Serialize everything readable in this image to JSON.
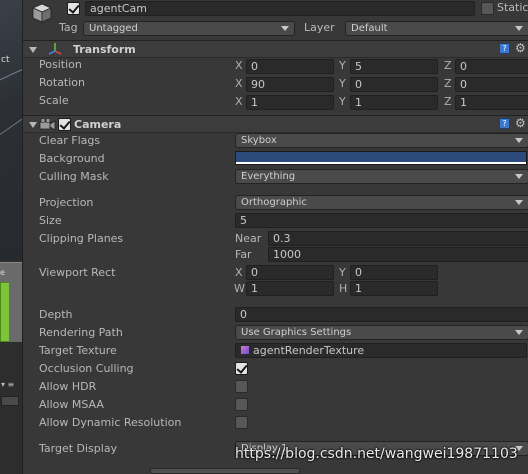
{
  "gameobject": {
    "name": "agentCam",
    "active": true,
    "static_label": "Static",
    "static": false,
    "tag_label": "Tag",
    "tag_value": "Untagged",
    "layer_label": "Layer",
    "layer_value": "Default"
  },
  "transform": {
    "title": "Transform",
    "position": {
      "label": "Position",
      "x": "0",
      "y": "5",
      "z": "0"
    },
    "rotation": {
      "label": "Rotation",
      "x": "90",
      "y": "0",
      "z": "0"
    },
    "scale": {
      "label": "Scale",
      "x": "1",
      "y": "1",
      "z": "1"
    }
  },
  "axes": {
    "x": "X",
    "y": "Y",
    "z": "Z",
    "w": "W",
    "h": "H"
  },
  "camera": {
    "title": "Camera",
    "enabled": true,
    "clear_flags": {
      "label": "Clear Flags",
      "value": "Skybox"
    },
    "background": {
      "label": "Background",
      "color": "#2d4a7c"
    },
    "culling_mask": {
      "label": "Culling Mask",
      "value": "Everything"
    },
    "projection": {
      "label": "Projection",
      "value": "Orthographic"
    },
    "size": {
      "label": "Size",
      "value": "5"
    },
    "clipping": {
      "label": "Clipping Planes",
      "near_label": "Near",
      "near": "0.3",
      "far_label": "Far",
      "far": "1000"
    },
    "viewport": {
      "label": "Viewport Rect",
      "x": "0",
      "y": "0",
      "w": "1",
      "h": "1"
    },
    "depth": {
      "label": "Depth",
      "value": "0"
    },
    "rendering_path": {
      "label": "Rendering Path",
      "value": "Use Graphics Settings"
    },
    "target_texture": {
      "label": "Target Texture",
      "value": "agentRenderTexture"
    },
    "occlusion_culling": {
      "label": "Occlusion Culling",
      "checked": true
    },
    "allow_hdr": {
      "label": "Allow HDR",
      "checked": false
    },
    "allow_msaa": {
      "label": "Allow MSAA",
      "checked": false
    },
    "allow_dynamic_resolution": {
      "label": "Allow Dynamic Resolution",
      "checked": false
    },
    "target_display": {
      "label": "Target Display",
      "value": "Display 1"
    }
  },
  "left_panel": {
    "scene_label": "ct",
    "tag": "e"
  },
  "watermark": "https://blog.csdn.net/wangwei19871103"
}
